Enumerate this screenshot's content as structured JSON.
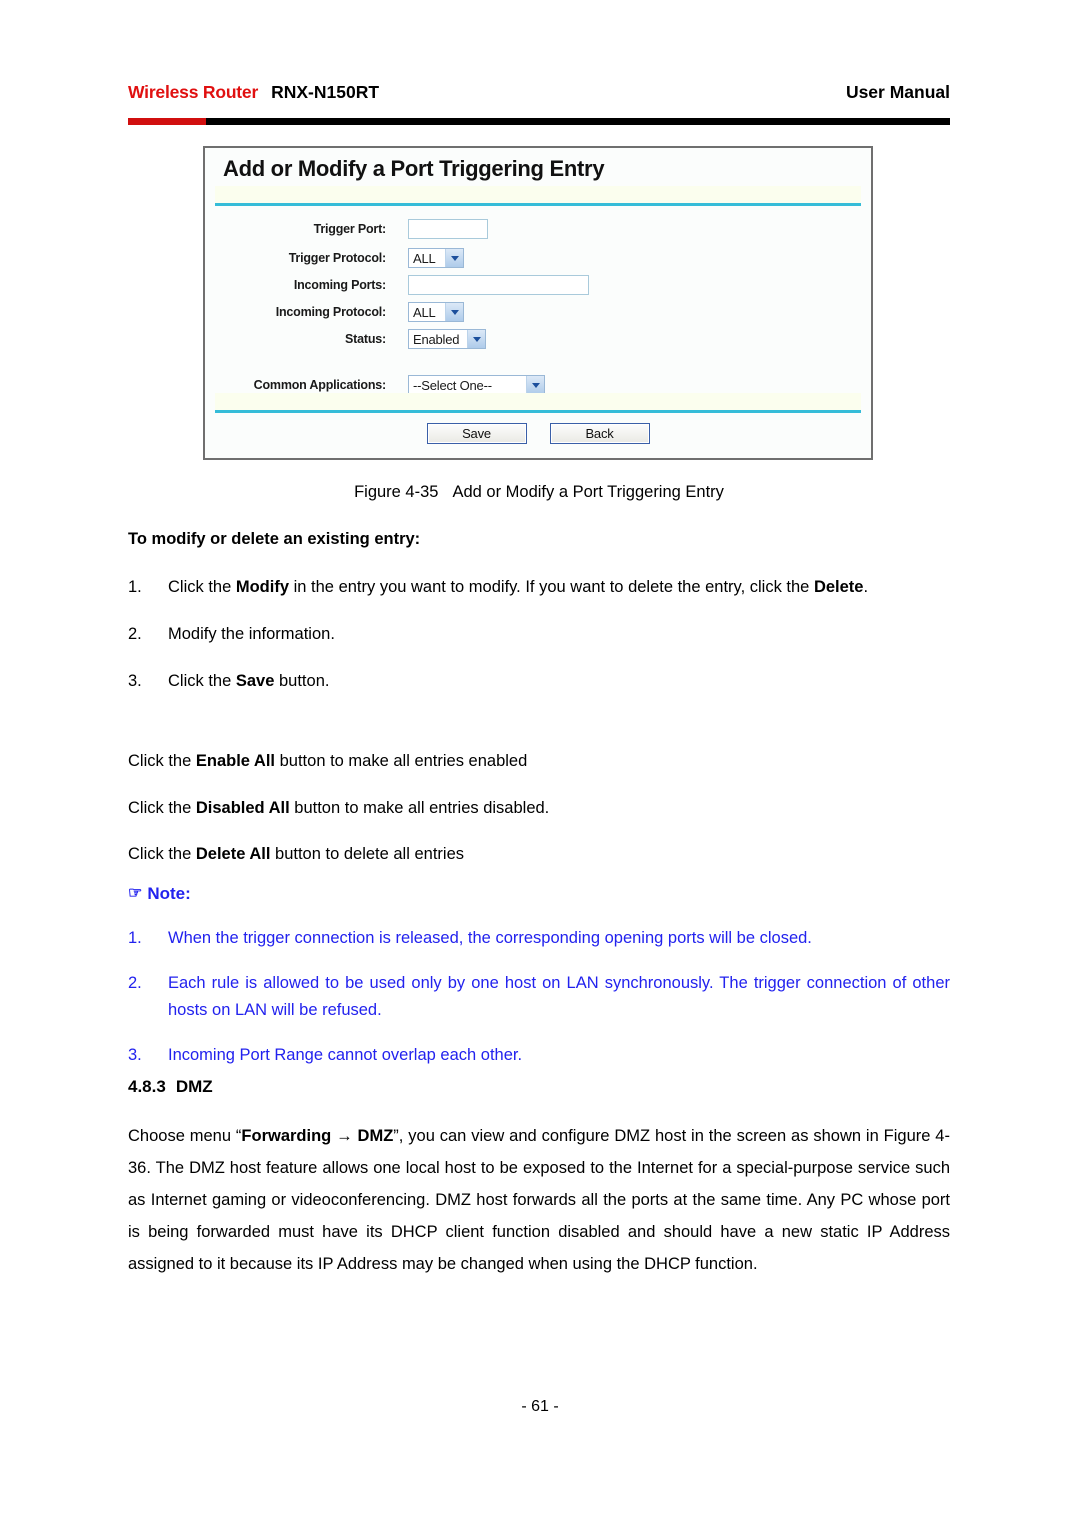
{
  "header": {
    "brand": "Wireless Router",
    "model": "RNX-N150RT",
    "right": "User Manual",
    "rule_red": "#d10f0f",
    "rule_black": "#000000"
  },
  "figure": {
    "title": "Add or Modify a Port Triggering Entry",
    "accent_color": "#35bcd8",
    "fields": [
      {
        "label": "Trigger Port:",
        "control": "textbox",
        "value": "",
        "width": "short"
      },
      {
        "label": "Trigger Protocol:",
        "control": "select",
        "value": "ALL",
        "width": "w-all"
      },
      {
        "label": "Incoming Ports:",
        "control": "textbox",
        "value": "",
        "width": "long"
      },
      {
        "label": "Incoming Protocol:",
        "control": "select",
        "value": "ALL",
        "width": "w-all"
      },
      {
        "label": "Status:",
        "control": "select",
        "value": "Enabled",
        "width": "w-status"
      },
      {
        "label": "Common Applications:",
        "control": "select",
        "value": "--Select One--",
        "width": "w-app"
      }
    ],
    "buttons": {
      "save": "Save",
      "back": "Back"
    }
  },
  "caption": {
    "number": "Figure 4-35",
    "text": "Add or Modify a Port Triggering Entry"
  },
  "subhead": "To modify or delete an existing entry:",
  "steps": [
    {
      "num": "1.",
      "parts": [
        {
          "t": "Click the ",
          "b": false
        },
        {
          "t": "Modify",
          "b": true
        },
        {
          "t": " in the entry you want to modify. If you want to delete the entry, click the ",
          "b": false
        },
        {
          "t": "Delete",
          "b": true
        },
        {
          "t": ".",
          "b": false
        }
      ]
    },
    {
      "num": "2.",
      "parts": [
        {
          "t": "Modify the information.",
          "b": false
        }
      ]
    },
    {
      "num": "3.",
      "parts": [
        {
          "t": "Click the ",
          "b": false
        },
        {
          "t": "Save",
          "b": true
        },
        {
          "t": " button.",
          "b": false
        }
      ]
    }
  ],
  "paragraphs": [
    {
      "parts": [
        {
          "t": "Click the ",
          "b": false
        },
        {
          "t": "Enable All",
          "b": true
        },
        {
          "t": " button to make all entries enabled",
          "b": false
        }
      ]
    },
    {
      "parts": [
        {
          "t": "Click the ",
          "b": false
        },
        {
          "t": "Disabled All",
          "b": true
        },
        {
          "t": " button to make all entries disabled.",
          "b": false
        }
      ]
    },
    {
      "parts": [
        {
          "t": "Click the ",
          "b": false
        },
        {
          "t": "Delete All",
          "b": true
        },
        {
          "t": " button to delete all entries",
          "b": false
        }
      ]
    }
  ],
  "note": {
    "icon": "☞",
    "label": "Note:",
    "color": "#2222ee",
    "items": [
      {
        "num": "1.",
        "text": "When the trigger connection is released, the corresponding opening ports will be closed."
      },
      {
        "num": "2.",
        "text": "Each rule is allowed to be used only by one host on LAN synchronously. The trigger connection of other hosts on LAN will be refused."
      },
      {
        "num": "3.",
        "text": "Incoming Port Range cannot overlap each other."
      }
    ]
  },
  "section": {
    "number": "4.8.3",
    "title": "DMZ",
    "body_parts": [
      {
        "t": "Choose menu “",
        "b": false
      },
      {
        "t": "Forwarding",
        "b": true
      },
      {
        "t": " → ",
        "b": true
      },
      {
        "t": "DMZ",
        "b": true
      },
      {
        "t": "”, you can view and configure DMZ host in the screen as shown in Figure 4-36. The DMZ host feature allows one local host to be exposed to the Internet for a special-purpose service such as Internet gaming or videoconferencing. DMZ host forwards all the ports at the same time. Any PC whose port is being forwarded must have its DHCP client function disabled and should have a new static IP Address assigned to it because its IP Address may be changed when using the DHCP function.",
        "b": false
      }
    ]
  },
  "footer": "- 61 -"
}
